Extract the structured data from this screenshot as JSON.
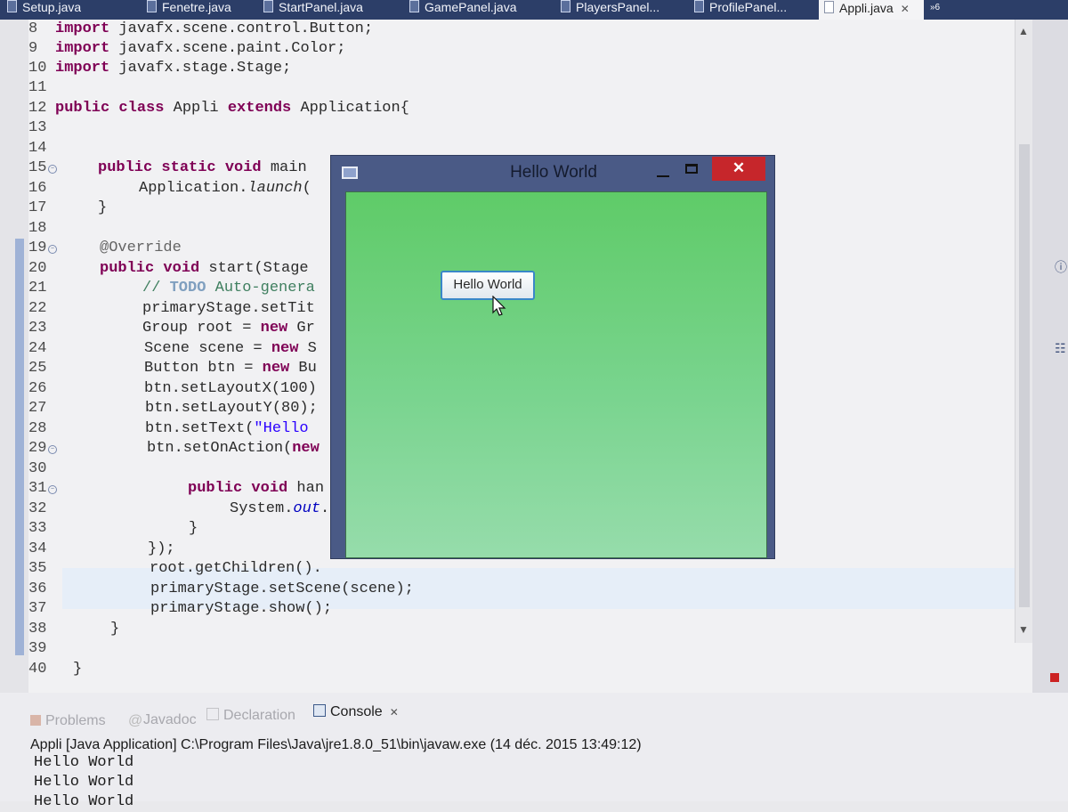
{
  "editor_tabs": [
    {
      "label": "Setup.java"
    },
    {
      "label": "Fenetre.java"
    },
    {
      "label": "StartPanel.java"
    },
    {
      "label": "GamePanel.java"
    },
    {
      "label": "PlayersPanel..."
    },
    {
      "label": "ProfilePanel..."
    },
    {
      "label": "Appli.java",
      "active": true
    }
  ],
  "tabs_overflow": "»6",
  "line_numbers": [
    "8",
    "9",
    "10",
    "11",
    "12",
    "13",
    "14",
    "15",
    "16",
    "17",
    "18",
    "19",
    "20",
    "21",
    "22",
    "23",
    "24",
    "25",
    "26",
    "27",
    "28",
    "29",
    "30",
    "31",
    "32",
    "33",
    "34",
    "35",
    "36",
    "37",
    "38",
    "39",
    "40"
  ],
  "code": {
    "l8_kw": "import",
    "l8_rest": " javafx.scene.control.Button;",
    "l9_kw": "import",
    "l9_rest": " javafx.scene.paint.Color;",
    "l10_kw": "import",
    "l10_rest": " javafx.stage.Stage;",
    "l12_kw1": "public class",
    "l12_mid": " Appli ",
    "l12_kw2": "extends",
    "l12_rest": " Application{",
    "l15_kw": "public static void",
    "l15_rest": " main",
    "l16_a": "Application.",
    "l16_b": "launch",
    "l16_c": "(",
    "l17": "}",
    "l19": "@Override",
    "l20_kw": "public void",
    "l20_rest": " start(Stage",
    "l21_a": "// ",
    "l21_todo": "TODO",
    "l21_b": " Auto-genera",
    "l22": "primaryStage.setTit",
    "l23_a": "Group root = ",
    "l23_kw": "new",
    "l23_b": " Gr",
    "l24_a": "Scene scene = ",
    "l24_kw": "new",
    "l24_b": " S",
    "l25_a": "Button btn = ",
    "l25_kw": "new",
    "l25_b": " Bu",
    "l26": "btn.setLayoutX(100)",
    "l27": "btn.setLayoutY(80);",
    "l28_a": "btn.setText(",
    "l28_str": "\"Hello",
    "l29_a": "btn.setOnAction(",
    "l29_kw": "new",
    "l31_kw": "public void",
    "l31_rest": " han",
    "l32_a": "System.",
    "l32_field": "out",
    "l32_b": ".",
    "l33": "}",
    "l34": "});",
    "l35": "root.getChildren().",
    "l36": "primaryStage.setScene(scene);",
    "l37": "primaryStage.show();",
    "l38": "}",
    "l40": "}"
  },
  "fx_window": {
    "title": "Hello World",
    "close_symbol": "✕",
    "button_label": "Hello World",
    "scene_color": "#6fd07c"
  },
  "bottom_panel": {
    "tabs": [
      {
        "label": "Problems"
      },
      {
        "label": "Javadoc"
      },
      {
        "label": "Declaration"
      },
      {
        "label": "Console",
        "active": true
      }
    ],
    "console_description": "Appli [Java Application] C:\\Program Files\\Java\\jre1.8.0_51\\bin\\javaw.exe (14 déc. 2015 13:49:12)",
    "output": [
      "Hello World",
      "Hello World",
      "Hello World"
    ]
  }
}
